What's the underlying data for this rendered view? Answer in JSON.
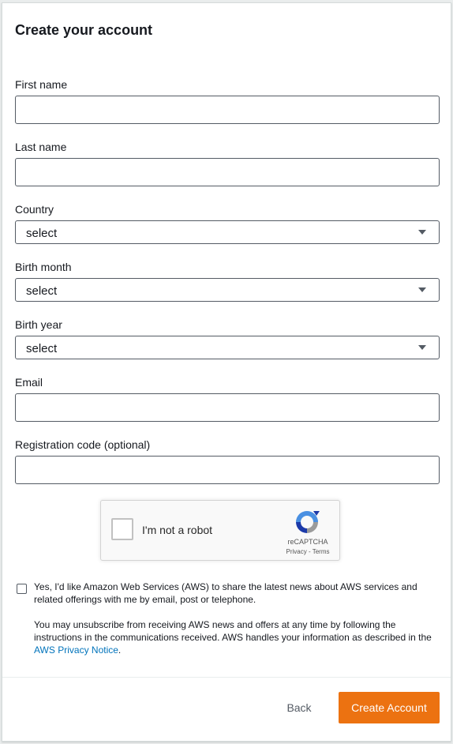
{
  "form": {
    "title": "Create your account",
    "first_name": {
      "label": "First name",
      "value": "",
      "placeholder": ""
    },
    "last_name": {
      "label": "Last name",
      "value": "",
      "placeholder": ""
    },
    "country": {
      "label": "Country",
      "selected": "select"
    },
    "birth_month": {
      "label": "Birth month",
      "selected": "select"
    },
    "birth_year": {
      "label": "Birth year",
      "selected": "select"
    },
    "email": {
      "label": "Email",
      "value": "",
      "placeholder": ""
    },
    "registration_code": {
      "label": "Registration code (optional)",
      "value": "",
      "placeholder": ""
    }
  },
  "recaptcha": {
    "label": "I'm not a robot",
    "brand": "reCAPTCHA",
    "links": "Privacy - Terms",
    "checked": false
  },
  "consent": {
    "checked": false,
    "text": "Yes, I'd like Amazon Web Services (AWS) to share the latest news about AWS services and related offerings with me by email, post or telephone."
  },
  "notice": {
    "text": "You may unsubscribe from receiving AWS news and offers at any time by following the instructions in the communications received. AWS handles your information as described in the ",
    "link_label": "AWS Privacy Notice",
    "end": "."
  },
  "actions": {
    "back_label": "Back",
    "create_label": "Create Account"
  },
  "colors": {
    "primary_button": "#ec7211",
    "link": "#0073bb",
    "border": "#545b64"
  },
  "icons": {
    "select_caret": "caret-down-icon",
    "recaptcha_logo": "recaptcha-logo-icon"
  }
}
